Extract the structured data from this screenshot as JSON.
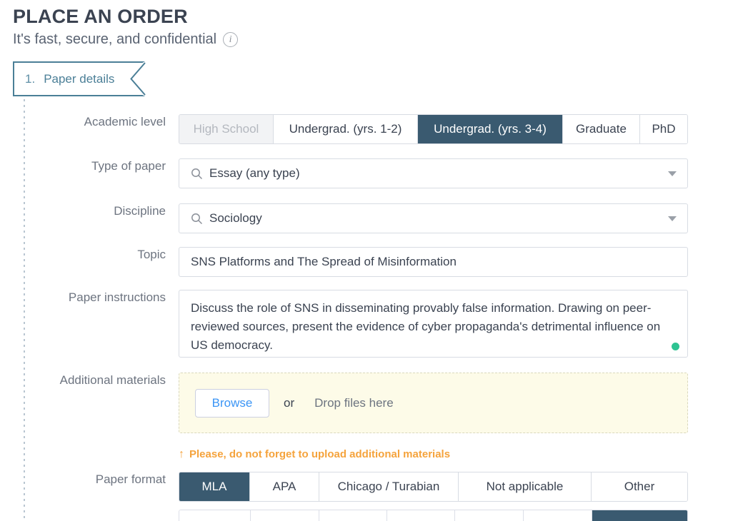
{
  "header": {
    "title": "PLACE AN ORDER",
    "subtitle": "It's fast, secure, and confidential",
    "info_icon": "info-icon",
    "info_glyph": "i"
  },
  "step": {
    "number": "1.",
    "label": "Paper details"
  },
  "colors": {
    "accent_dark": "#3a5a70",
    "tab_border": "#4b7f97",
    "tab_text": "#4b7f97",
    "warning_orange": "#f5a33c",
    "link_blue": "#3b95f5",
    "valid_green": "#2ec392",
    "dropzone_bg": "#fdfbe8",
    "label_grey": "#6d7480",
    "disabled_bg": "#f2f3f5",
    "disabled_text": "#b4b8bf",
    "border_grey": "#d8dce3"
  },
  "fields": {
    "academic_level": {
      "label": "Academic level",
      "options": [
        {
          "label": "High School",
          "state": "disabled"
        },
        {
          "label": "Undergrad. (yrs. 1-2)",
          "state": "normal"
        },
        {
          "label": "Undergrad. (yrs. 3-4)",
          "state": "selected"
        },
        {
          "label": "Graduate",
          "state": "normal"
        },
        {
          "label": "PhD",
          "state": "normal"
        }
      ]
    },
    "type_of_paper": {
      "label": "Type of paper",
      "value": "Essay (any type)",
      "icon": "search-icon",
      "caret": "chevron-down-icon"
    },
    "discipline": {
      "label": "Discipline",
      "value": "Sociology",
      "icon": "search-icon",
      "caret": "chevron-down-icon"
    },
    "topic": {
      "label": "Topic",
      "value": "SNS Platforms and The Spread of Misinformation",
      "placeholder": "Topic"
    },
    "paper_instructions": {
      "label": "Paper instructions",
      "value": "Discuss the role of SNS in disseminating provably false information. Drawing on peer-reviewed sources, present the evidence of cyber propaganda's detrimental influence on US democracy.",
      "placeholder": "Paper instructions",
      "status_indicator": "valid-green-dot"
    },
    "additional_materials": {
      "label": "Additional materials",
      "browse_label": "Browse",
      "or_label": "or",
      "drop_hint": "Drop files here",
      "warning_text": "Please, do not forget to upload additional materials",
      "warning_icon": "up-arrow-icon",
      "warning_glyph": "↑"
    },
    "paper_format": {
      "label": "Paper format",
      "options": [
        {
          "label": "MLA",
          "state": "selected"
        },
        {
          "label": "APA",
          "state": "normal"
        },
        {
          "label": "Chicago / Turabian",
          "state": "normal"
        },
        {
          "label": "Not applicable",
          "state": "normal"
        },
        {
          "label": "Other",
          "state": "normal"
        }
      ]
    },
    "next_row_partial": {
      "cells": [
        {
          "state": "normal"
        },
        {
          "state": "normal"
        },
        {
          "state": "normal"
        },
        {
          "state": "normal"
        },
        {
          "state": "normal"
        },
        {
          "state": "normal"
        },
        {
          "state": "selected"
        }
      ]
    }
  }
}
